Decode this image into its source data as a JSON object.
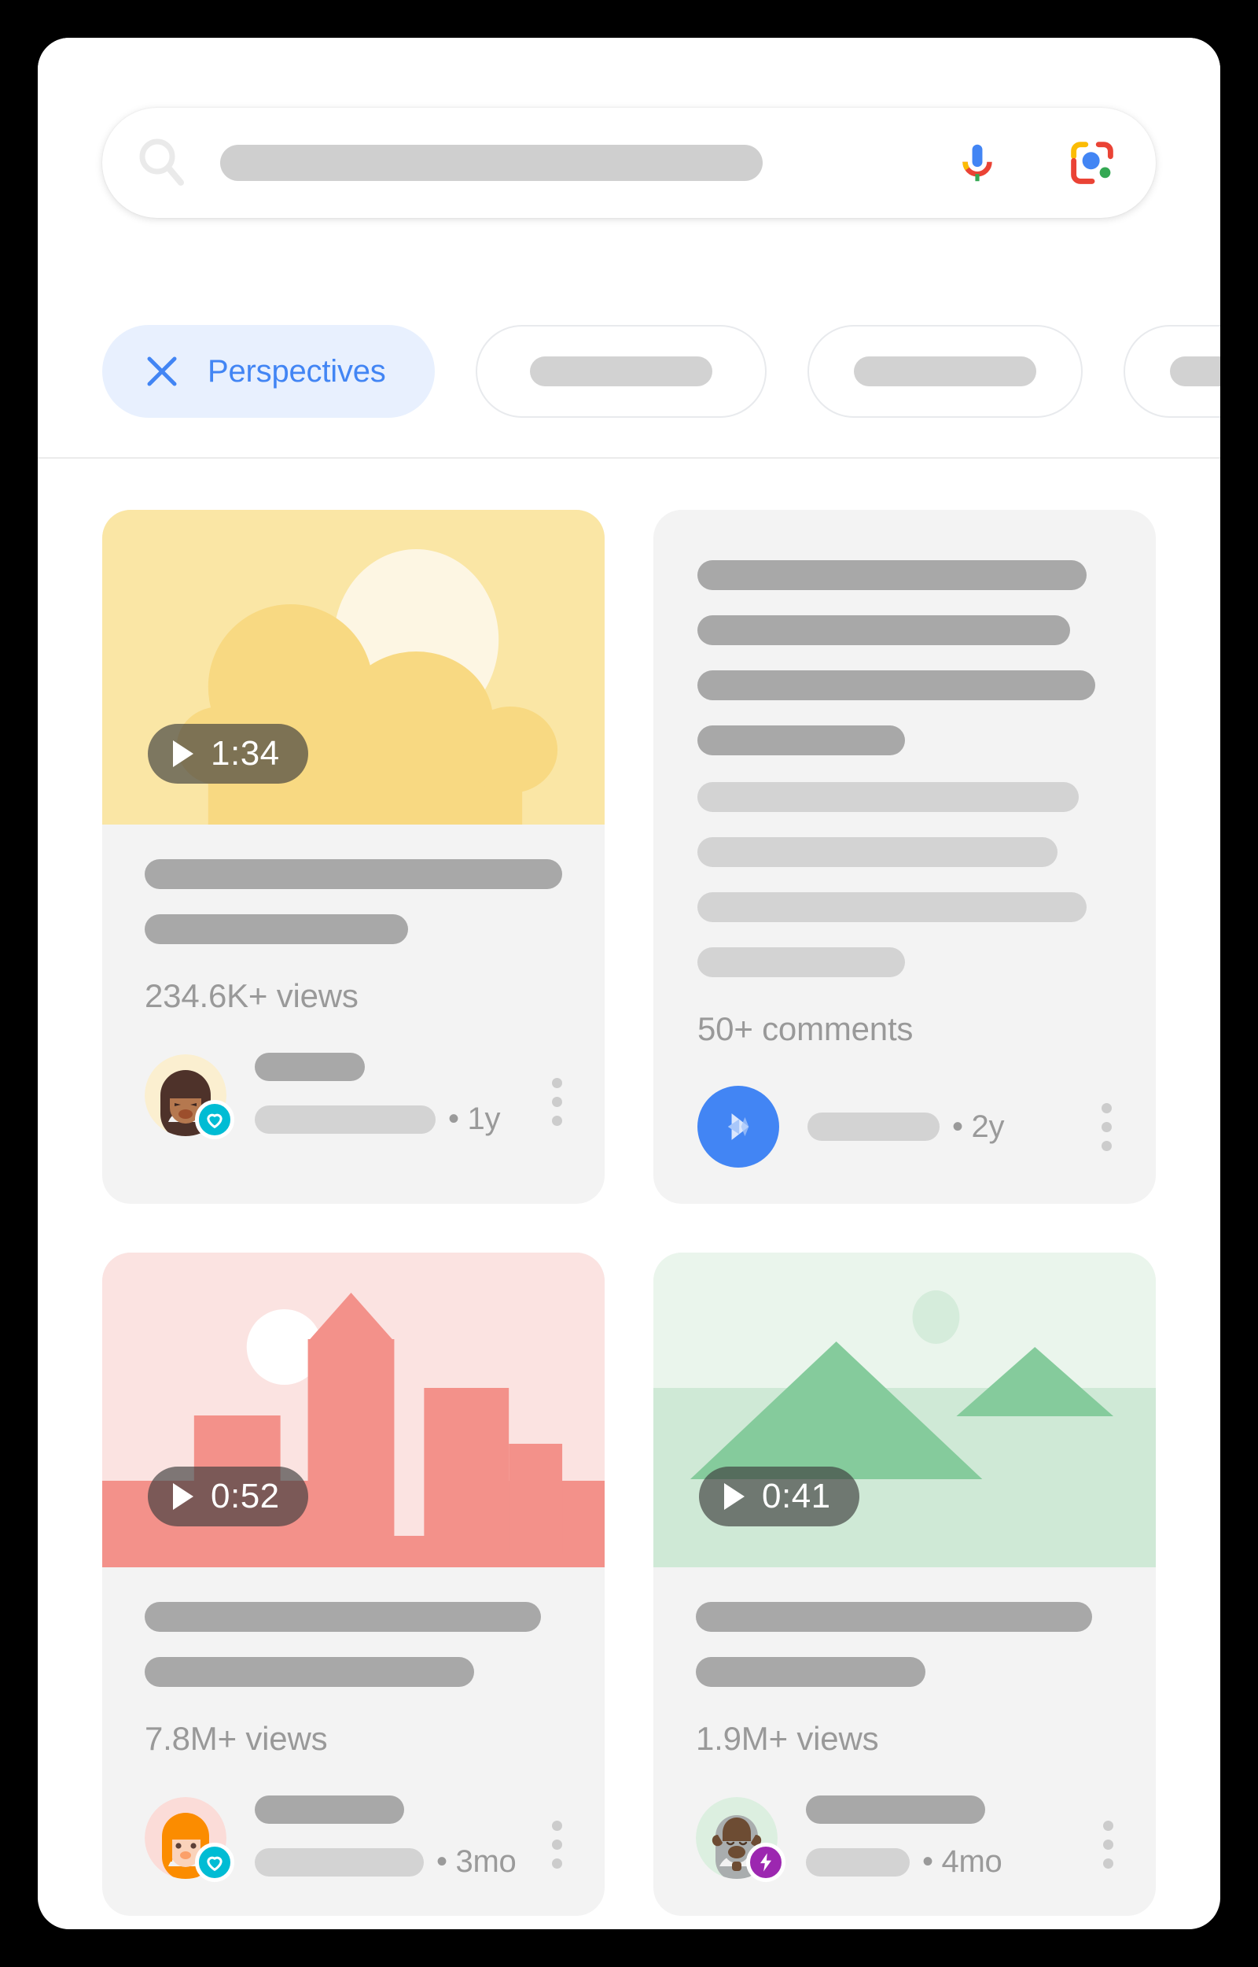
{
  "search": {
    "icon": "search-icon",
    "input_placeholder": "",
    "input_value": "",
    "mic_icon": "microphone-icon",
    "lens_icon": "google-lens-icon"
  },
  "filters": {
    "active_chip": {
      "label": "Perspectives",
      "icon": "close-x-icon",
      "accent_color": "#4285f4",
      "background_color": "#e8f0fe"
    },
    "placeholder_chips": [
      {
        "label": ""
      },
      {
        "label": ""
      },
      {
        "label": ""
      }
    ]
  },
  "cards": [
    {
      "type": "video",
      "thumbnail": "sun-and-clouds-illustration",
      "duration": "1:34",
      "meta": "234.6K+ views",
      "time_ago": "• 1y",
      "avatar": "woman-dark-hair-avatar",
      "badge": "heart-badge",
      "badge_color": "#00bcd4",
      "title_skeleton": true
    },
    {
      "type": "text",
      "meta": "50+ comments",
      "time_ago": "• 2y",
      "avatar": "blue-play-circle-icon",
      "badge": null,
      "badge_color": "#4285f4"
    },
    {
      "type": "video",
      "thumbnail": "pink-cityscape-illustration",
      "duration": "0:52",
      "meta": "7.8M+ views",
      "time_ago": "• 3mo",
      "avatar": "woman-orange-hair-avatar",
      "badge": "heart-badge",
      "badge_color": "#00bcd4",
      "title_skeleton": true
    },
    {
      "type": "video",
      "thumbnail": "green-mountains-illustration",
      "duration": "0:41",
      "meta": "1.9M+ views",
      "time_ago": "• 4mo",
      "avatar": "bison-avatar",
      "badge": "lightning-badge",
      "badge_color": "#9c27b0",
      "title_skeleton": true
    }
  ],
  "colors": {
    "card_background": "#f3f3f3",
    "page_background": "#ffffff",
    "frame_background": "#000000",
    "skeleton_dark": "#a8a8a8",
    "skeleton_light": "#d3d3d3",
    "meta_text": "#999999",
    "thumb_yellow_bg": "#fae6a5",
    "thumb_pink_bg": "#fbe3e1",
    "thumb_green_bg": "#e4f2e6"
  },
  "menu": {
    "kebab_label": "more-options"
  }
}
